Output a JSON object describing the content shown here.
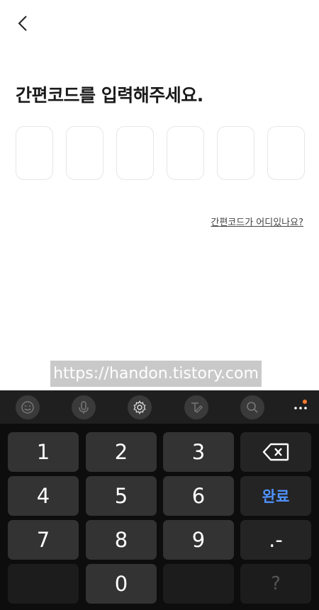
{
  "header": {
    "back_icon": "chevron-left-icon"
  },
  "main": {
    "title": "간편코드를 입력해주세요.",
    "code_digits": [
      "",
      "",
      "",
      "",
      "",
      ""
    ],
    "help_link": "간편코드가 어디있나요?"
  },
  "watermark": "https://handon.tistory.com",
  "keyboard": {
    "toolbar_icons": [
      "emoji-icon",
      "microphone-icon",
      "settings-gear-icon",
      "handwriting-icon",
      "search-icon",
      "more-options-icon"
    ],
    "keys": {
      "k1": "1",
      "k2": "2",
      "k3": "3",
      "k4": "4",
      "k5": "5",
      "k6": "6",
      "k7": "7",
      "k8": "8",
      "k9": "9",
      "k0": "0",
      "done": "완료",
      "dot_dash": ".-",
      "question": "?"
    },
    "colors": {
      "accent": "#4f93ff",
      "badge": "#ff7a30",
      "key_bg": "#333333",
      "keyboard_bg": "#0d0d0d"
    }
  }
}
